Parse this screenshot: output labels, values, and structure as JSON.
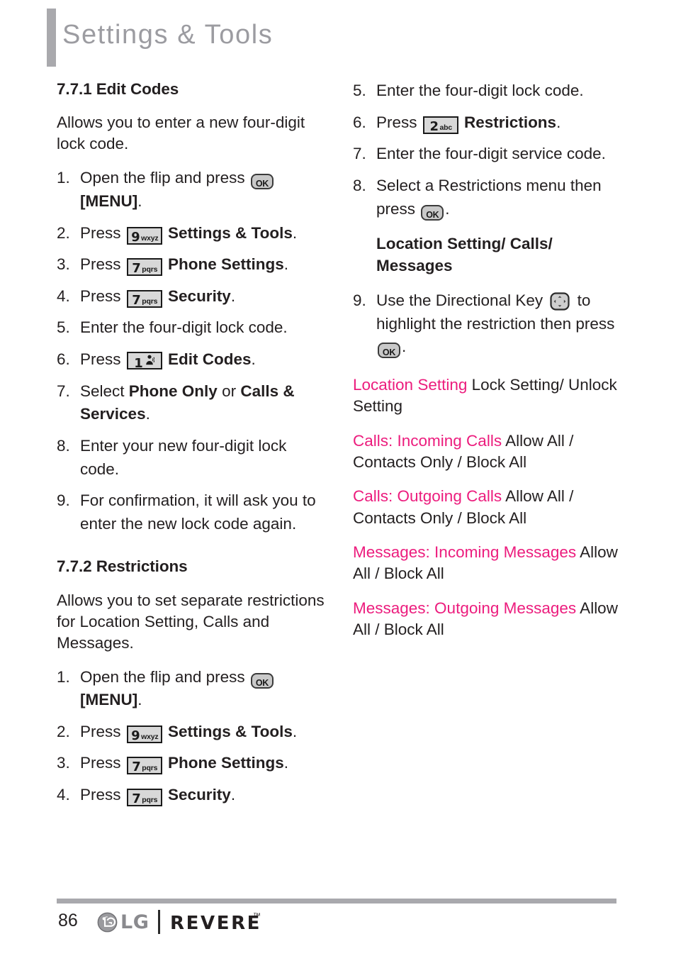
{
  "header": {
    "title": "Settings & Tools"
  },
  "left_column": {
    "section1": {
      "heading": "7.7.1 Edit Codes",
      "intro": "Allows you to enter a new four-digit lock code.",
      "steps": [
        {
          "num": "1.",
          "pre": "Open the flip and press ",
          "key": "ok",
          "post": "",
          "bold_after": " [MENU]",
          "tail": "."
        },
        {
          "num": "2.",
          "pre": "Press ",
          "key": "9wxyz",
          "post": " ",
          "bold_after": "Settings & Tools",
          "tail": "."
        },
        {
          "num": "3.",
          "pre": "Press ",
          "key": "7pqrs",
          "post": " ",
          "bold_after": "Phone Settings",
          "tail": "."
        },
        {
          "num": "4.",
          "pre": "Press ",
          "key": "7pqrs",
          "post": " ",
          "bold_after": "Security",
          "tail": "."
        },
        {
          "num": "5.",
          "pre": "Enter the four-digit lock code.",
          "key": "",
          "post": "",
          "bold_after": "",
          "tail": ""
        },
        {
          "num": "6.",
          "pre": "Press ",
          "key": "1vm",
          "post": " ",
          "bold_after": "Edit Codes",
          "tail": "."
        },
        {
          "num": "7.",
          "pre": "Select ",
          "key": "",
          "post": "",
          "bold_after": "Phone Only",
          "mid": " or ",
          "bold_after2": "Calls & Services",
          "tail": "."
        },
        {
          "num": "8.",
          "pre": "Enter your new four-digit lock code.",
          "key": "",
          "post": "",
          "bold_after": "",
          "tail": ""
        },
        {
          "num": "9.",
          "pre": "For confirmation, it will ask you to enter the new lock code again.",
          "key": "",
          "post": "",
          "bold_after": "",
          "tail": ""
        }
      ]
    },
    "section2": {
      "heading": "7.7.2 Restrictions",
      "intro": "Allows you to set separate restrictions for Location Setting, Calls and Messages.",
      "steps": [
        {
          "num": "1.",
          "pre": "Open the flip and press ",
          "key": "ok",
          "post": "",
          "bold_after": " [MENU]",
          "tail": "."
        },
        {
          "num": "2.",
          "pre": "Press ",
          "key": "9wxyz",
          "post": " ",
          "bold_after": "Settings & Tools",
          "tail": "."
        },
        {
          "num": "3.",
          "pre": "Press ",
          "key": "7pqrs",
          "post": " ",
          "bold_after": "Phone Settings",
          "tail": "."
        },
        {
          "num": "4.",
          "pre": "Press ",
          "key": "7pqrs",
          "post": " ",
          "bold_after": "Security",
          "tail": "."
        }
      ]
    }
  },
  "right_column": {
    "steps": [
      {
        "num": "5.",
        "pre": "Enter the four-digit lock code.",
        "key": "",
        "post": "",
        "bold_after": "",
        "tail": ""
      },
      {
        "num": "6.",
        "pre": "Press ",
        "key": "2abc",
        "post": " ",
        "bold_after": "Restrictions",
        "tail": "."
      },
      {
        "num": "7.",
        "pre": "Enter the four-digit service code.",
        "key": "",
        "post": "",
        "bold_after": "",
        "tail": ""
      },
      {
        "num": "8.",
        "pre": "Select a Restrictions menu then press ",
        "key": "ok",
        "post": "",
        "bold_after": "",
        "tail": "."
      }
    ],
    "subheading": "Location Setting/ Calls/ Messages",
    "step9": {
      "num": "9.",
      "pre": "Use the Directional Key ",
      "key": "dir",
      "post": " to highlight the restriction then press ",
      "key2": "ok",
      "tail": "."
    },
    "options": [
      {
        "name": "Location Setting",
        "values": " Lock Setting/ Unlock Setting"
      },
      {
        "name": "Calls: Incoming Calls",
        "values": " Allow All / Contacts Only / Block All"
      },
      {
        "name": "Calls: Outgoing Calls",
        "values": " Allow All / Contacts Only / Block All"
      },
      {
        "name": "Messages: Incoming Messages",
        "values": " Allow All / Block All"
      },
      {
        "name": "Messages: Outgoing Messages",
        "values": " Allow All / Block All"
      }
    ]
  },
  "keys": {
    "ok_label": "OK",
    "nine": {
      "digit": "9",
      "letters": "wxyz"
    },
    "seven": {
      "digit": "7",
      "letters": "pqrs"
    },
    "two": {
      "digit": "2",
      "letters": "abc"
    },
    "one": {
      "digit": "1",
      "letters": ""
    }
  },
  "footer": {
    "page_number": "86",
    "brand": "LG",
    "model": "REVERE",
    "trademark": "™"
  },
  "colors": {
    "accent_pink": "#ec1c7d",
    "header_gray": "#9c9ca1",
    "rule_gray": "#a9a9ad"
  }
}
